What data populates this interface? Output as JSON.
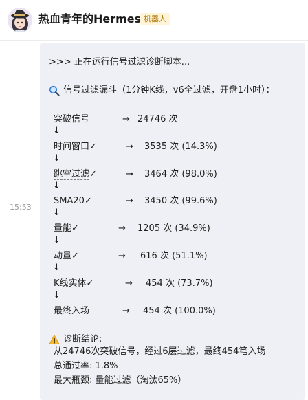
{
  "header": {
    "bot_name": "热血青年的Hermes",
    "badge": "机器人"
  },
  "message": {
    "time": "15:53",
    "running_line": ">>> 正在运行信号过滤诊断脚本...",
    "funnel_title": "信号过滤漏斗（1分钟K线，v6全过滤，开盘1小时）：",
    "arrow": "↓",
    "funnel_arrow": "→",
    "steps": [
      {
        "label": "突破信号",
        "count": "24746 次"
      },
      {
        "label": "时间窗口✓",
        "count": "3535 次 (14.3%)"
      },
      {
        "label": "跳空过滤✓",
        "count": "3464 次 (98.0%)"
      },
      {
        "label": "SMA20✓",
        "count": "3450 次 (99.6%)"
      },
      {
        "label": "量能✓",
        "count": "1205 次 (34.9%)"
      },
      {
        "label": "动量✓",
        "count": "616 次 (51.1%)"
      },
      {
        "label": "K线实体✓",
        "count": "454 次 (73.7%)"
      },
      {
        "label": "最终入场",
        "count": "454 次 (100.0%)"
      }
    ],
    "conclusion_title": "诊断结论:",
    "conclusion_lines": [
      "从24746次突破信号，经过6层过滤，最终454笔入场",
      "总通过率: 1.8%",
      "最大瓶颈: 量能过滤（淘汰65%）"
    ]
  },
  "colors": {
    "bubble_bg": "#eff0f5",
    "badge_bg": "#fff4d6",
    "badge_text": "#b07a10"
  }
}
